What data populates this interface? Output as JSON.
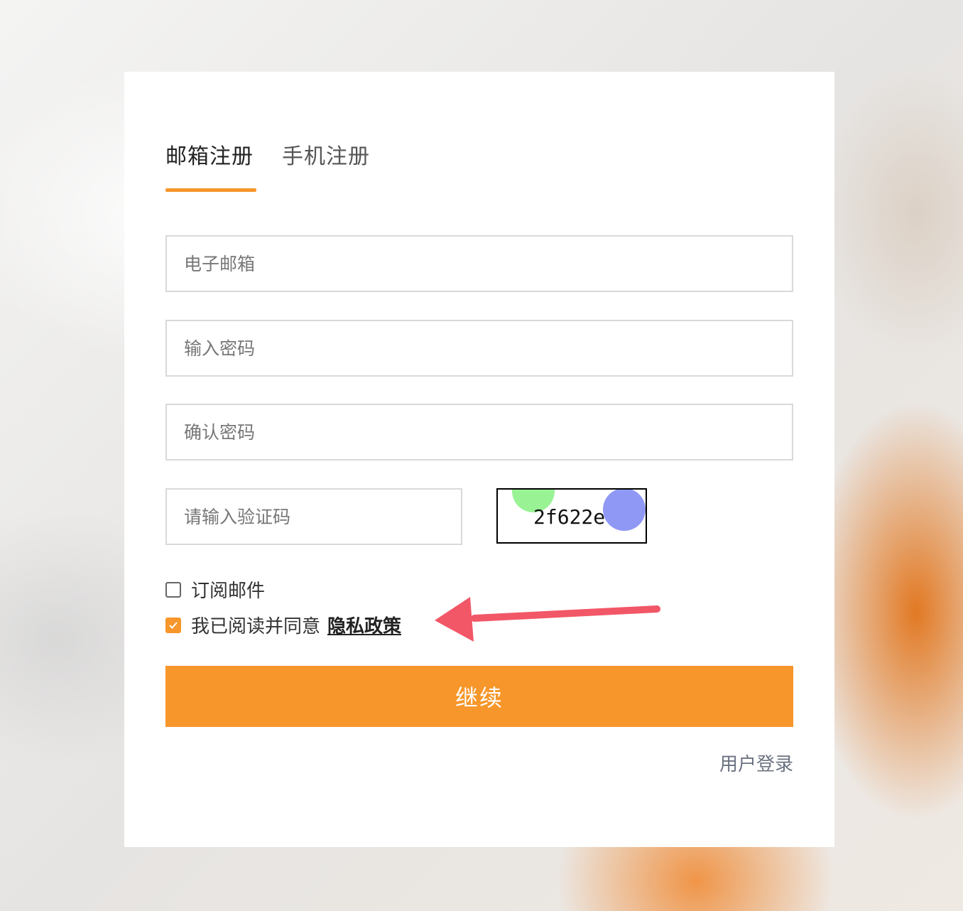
{
  "tabs": [
    {
      "label": "邮箱注册",
      "active": true
    },
    {
      "label": "手机注册",
      "active": false
    }
  ],
  "form": {
    "email_placeholder": "电子邮箱",
    "password_placeholder": "输入密码",
    "confirm_placeholder": "确认密码",
    "captcha_placeholder": "请输入验证码",
    "captcha_text": "2f622e"
  },
  "checkboxes": {
    "subscribe_label": "订阅邮件",
    "subscribe_checked": false,
    "agree_label": "我已阅读并同意",
    "agree_checked": true,
    "privacy_link": "隐私政策"
  },
  "actions": {
    "continue_label": "继续",
    "login_link": "用户登录"
  },
  "colors": {
    "accent": "#f7962a",
    "annotation_arrow": "#f25767"
  },
  "icons": [
    "checkmark-icon",
    "annotation-arrow-icon"
  ]
}
